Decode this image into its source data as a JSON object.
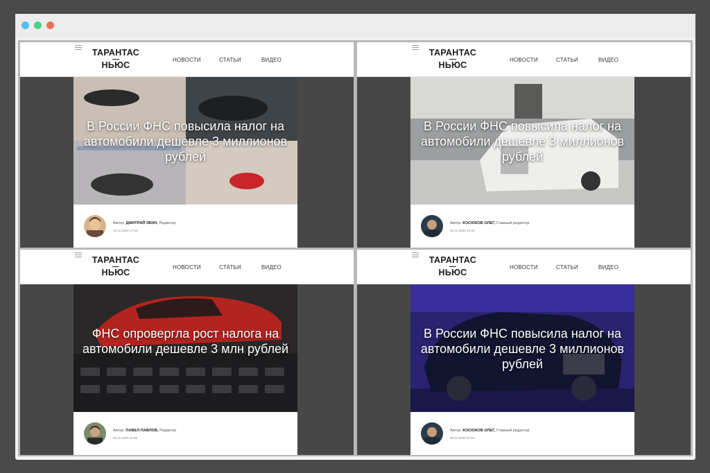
{
  "browser": {
    "dot_colors": [
      "#4dc2e8",
      "#4fd18a",
      "#ef6e5a"
    ]
  },
  "site": {
    "logo_top": "ТАРАНТАС",
    "logo_dash": "—",
    "logo_bottom": "НЬЮС",
    "nav": [
      "НОВОСТИ",
      "СТАТЬИ",
      "ВИДЕО"
    ]
  },
  "cards": [
    {
      "headline": "В России ФНС повысила налог на автомобили дешевле 3 миллионов рублей",
      "author_prefix": "Автор:",
      "author_name": "ДМИТРИЙ ЯКИН,",
      "author_role": "Редактор",
      "date": "02.11.2020 17:45",
      "image": "model-cars-collage"
    },
    {
      "headline": "В России ФНС повысила налог на автомобили дешевле 3 миллионов рублей",
      "author_prefix": "Автор:",
      "author_name": "КОСЮКОВ ОЛЕГ,",
      "author_role": "Главный редактор",
      "date": "02.11.2020 13:35",
      "image": "white-rolls-royce-showroom"
    },
    {
      "headline": "ФНС опровергла рост налога на автомобили дешевле 3 млн рублей",
      "author_prefix": "Автор:",
      "author_name": "ПАВЕЛ ПАВЛОВ,",
      "author_role": "Редактор",
      "date": "26.11.2020 11:58",
      "image": "red-model-car-on-calculator"
    },
    {
      "headline": "В России ФНС повысила налог на автомобили дешевле 3 миллионов рублей",
      "author_prefix": "Автор:",
      "author_name": "КОСЮКОВ ОЛЕГ,",
      "author_role": "Главный редактор",
      "date": "05.11.2020 07:53",
      "image": "maybach-purple-showroom"
    }
  ]
}
